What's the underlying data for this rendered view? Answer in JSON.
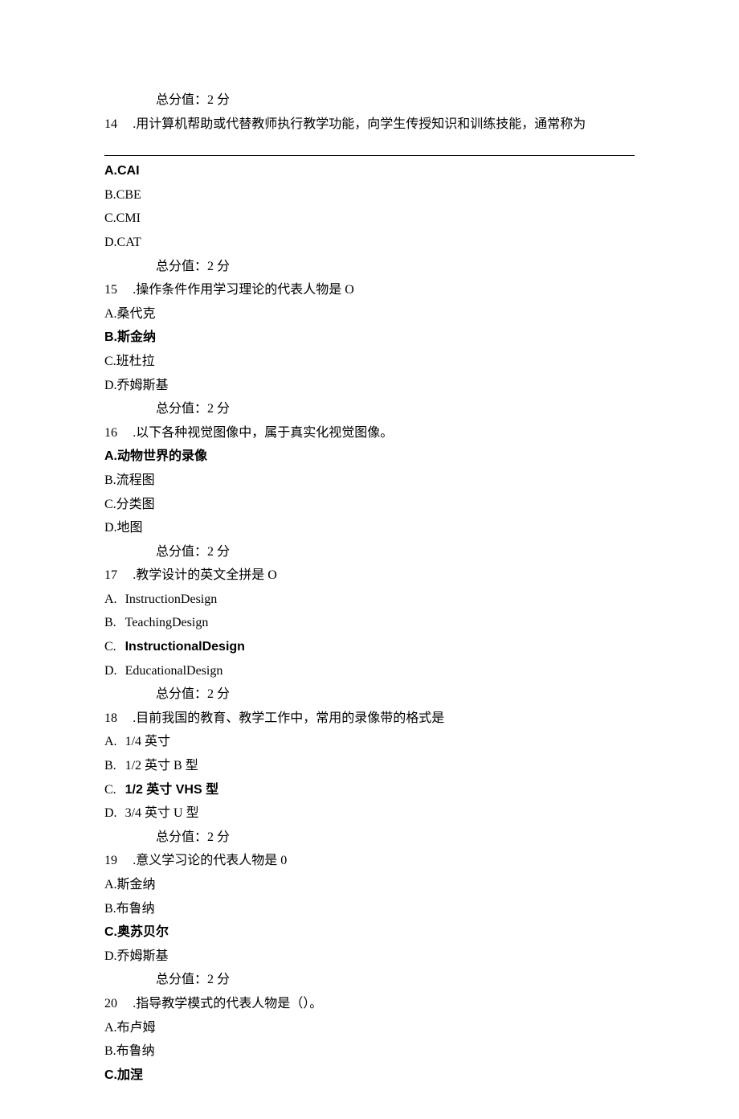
{
  "score_label": "总分值：2 分",
  "q14": {
    "num": "14",
    "text": ".用计算机帮助或代替教师执行教学功能，向学生传授知识和训练技能，通常称为",
    "a": "A.CAI",
    "b": "B.CBE",
    "c": "C.CMI",
    "d": "D.CAT"
  },
  "q15": {
    "num": "15",
    "text": ".操作条件作用学习理论的代表人物是 O",
    "a": "A.桑代克",
    "b": "B.斯金纳",
    "c": "C.班杜拉",
    "d": "D.乔姆斯基"
  },
  "q16": {
    "num": "16",
    "text": ".以下各种视觉图像中，属于真实化视觉图像。",
    "a": "A.动物世界的录像",
    "b": "B.流程图",
    "c": "C.分类图",
    "d": "D.地图"
  },
  "q17": {
    "num": "17",
    "text": ".教学设计的英文全拼是 O",
    "al": "A.",
    "a": "InstructionDesign",
    "bl": "B.",
    "b": "TeachingDesign",
    "cl": "C.",
    "c": "InstructionalDesign",
    "dl": "D.",
    "d": "EducationalDesign"
  },
  "q18": {
    "num": "18",
    "text": ".目前我国的教育、教学工作中，常用的录像带的格式是",
    "al": "A.",
    "a": "1/4 英寸",
    "bl": "B.",
    "b": "1/2 英寸 B 型",
    "cl": "C.",
    "c": "1/2 英寸 VHS 型",
    "dl": "D.",
    "d": "3/4 英寸 U 型"
  },
  "q19": {
    "num": "19",
    "text": ".意义学习论的代表人物是 0",
    "a": "A.斯金纳",
    "b": "B.布鲁纳",
    "c": "C.奥苏贝尔",
    "d": "D.乔姆斯基"
  },
  "q20": {
    "num": "20",
    "text": ".指导教学模式的代表人物是（）。",
    "a": "A.布卢姆",
    "b": "B.布鲁纳",
    "c": "C.加涅"
  }
}
